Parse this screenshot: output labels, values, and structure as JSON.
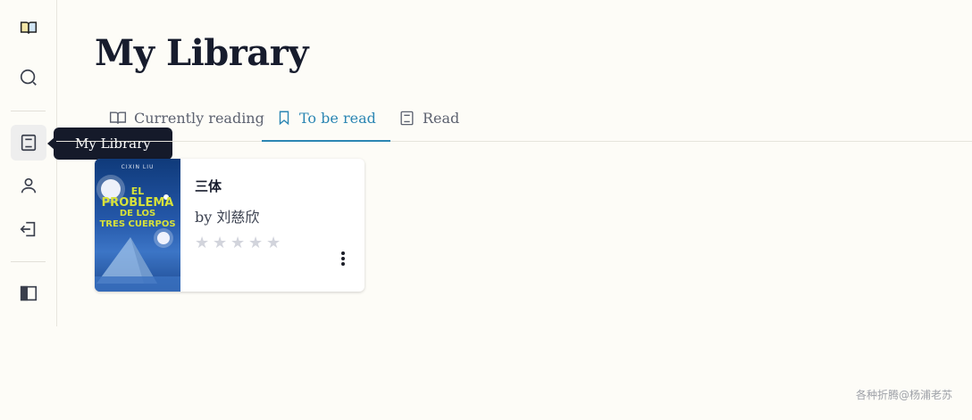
{
  "sidebar": {
    "items": [
      {
        "name": "library-logo",
        "icon": "book-open-icon"
      },
      {
        "name": "search",
        "icon": "search-icon"
      },
      {
        "name": "my-library",
        "icon": "book-icon",
        "active": true
      },
      {
        "name": "profile",
        "icon": "user-icon"
      },
      {
        "name": "logout",
        "icon": "logout-icon"
      },
      {
        "name": "toggle-sidebar",
        "icon": "sidebar-toggle-icon"
      }
    ],
    "tooltip": "My Library"
  },
  "page": {
    "title": "My Library"
  },
  "tabs": [
    {
      "label": "Currently reading",
      "icon": "book-open-icon",
      "active": false
    },
    {
      "label": "To be read",
      "icon": "bookmark-icon",
      "active": true
    },
    {
      "label": "Read",
      "icon": "book-icon",
      "active": false
    }
  ],
  "books": [
    {
      "title": "三体",
      "author_line": "by 刘慈欣",
      "rating": 0,
      "rating_max": 5,
      "cover": {
        "author": "CIXIN LIU",
        "title_lines": [
          "EL",
          "PROBLEMA",
          "DE LOS",
          "TRES CUERPOS"
        ]
      }
    }
  ],
  "watermark": "各种折腾@杨浦老苏",
  "colors": {
    "accent": "#2b86b3",
    "background": "#fdfcf7",
    "tooltip_bg": "#151a2a",
    "star_empty": "#d2d4dc"
  }
}
